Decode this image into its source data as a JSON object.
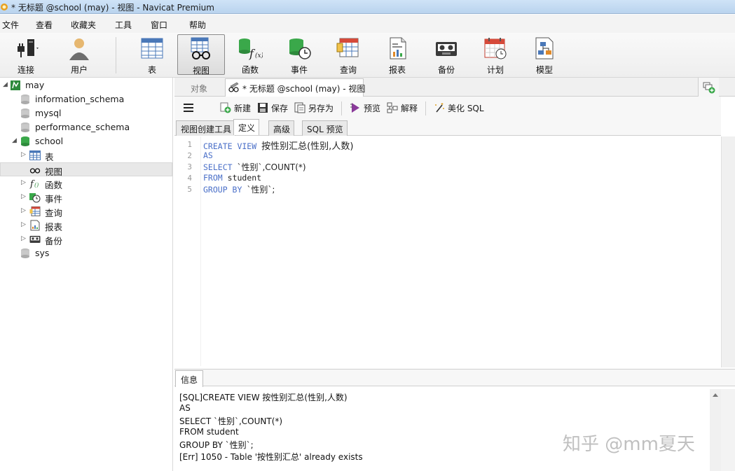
{
  "window": {
    "title": "* 无标题 @school (may) - 视图 - Navicat Premium"
  },
  "menu": [
    "文件",
    "查看",
    "收藏夹",
    "工具",
    "窗口",
    "帮助"
  ],
  "toolbar": {
    "connect": "连接",
    "user": "用户",
    "table": "表",
    "view": "视图",
    "function": "函数",
    "event": "事件",
    "query": "查询",
    "report": "报表",
    "backup": "备份",
    "schedule": "计划",
    "model": "模型"
  },
  "tree": {
    "connection": "may",
    "databases": [
      "information_schema",
      "mysql",
      "performance_schema",
      "school",
      "sys"
    ],
    "school_children": [
      "表",
      "视图",
      "函数",
      "事件",
      "查询",
      "报表",
      "备份"
    ]
  },
  "tabs": {
    "objects": "对象",
    "document": "* 无标题 @school (may) - 视图"
  },
  "editor_toolbar": {
    "new": "新建",
    "save": "保存",
    "save_as": "另存为",
    "preview": "预览",
    "explain": "解释",
    "beautify": "美化 SQL"
  },
  "subtabs": [
    "视图创建工具",
    "定义",
    "高级",
    "SQL 预览"
  ],
  "code": {
    "line_numbers": [
      "1",
      "2",
      "3",
      "4",
      "5"
    ],
    "l1_kw": "CREATE VIEW",
    "l1_rest": "按性别汇总(性别,人数)",
    "l2_kw": "AS",
    "l3_kw": "SELECT",
    "l3_rest": "`性别`,COUNT(*)",
    "l4_kw": "FROM",
    "l4_rest": "student",
    "l5_kw": "GROUP BY",
    "l5_rest": "`性别`;"
  },
  "info": {
    "tab": "信息",
    "lines": [
      "[SQL]CREATE VIEW 按性别汇总(性别,人数)",
      "AS",
      "SELECT `性别`,COUNT(*)",
      "FROM student",
      "GROUP BY `性别`;",
      "[Err] 1050 - Table '按性别汇总' already exists"
    ]
  },
  "watermark": "知乎 @mm夏天"
}
